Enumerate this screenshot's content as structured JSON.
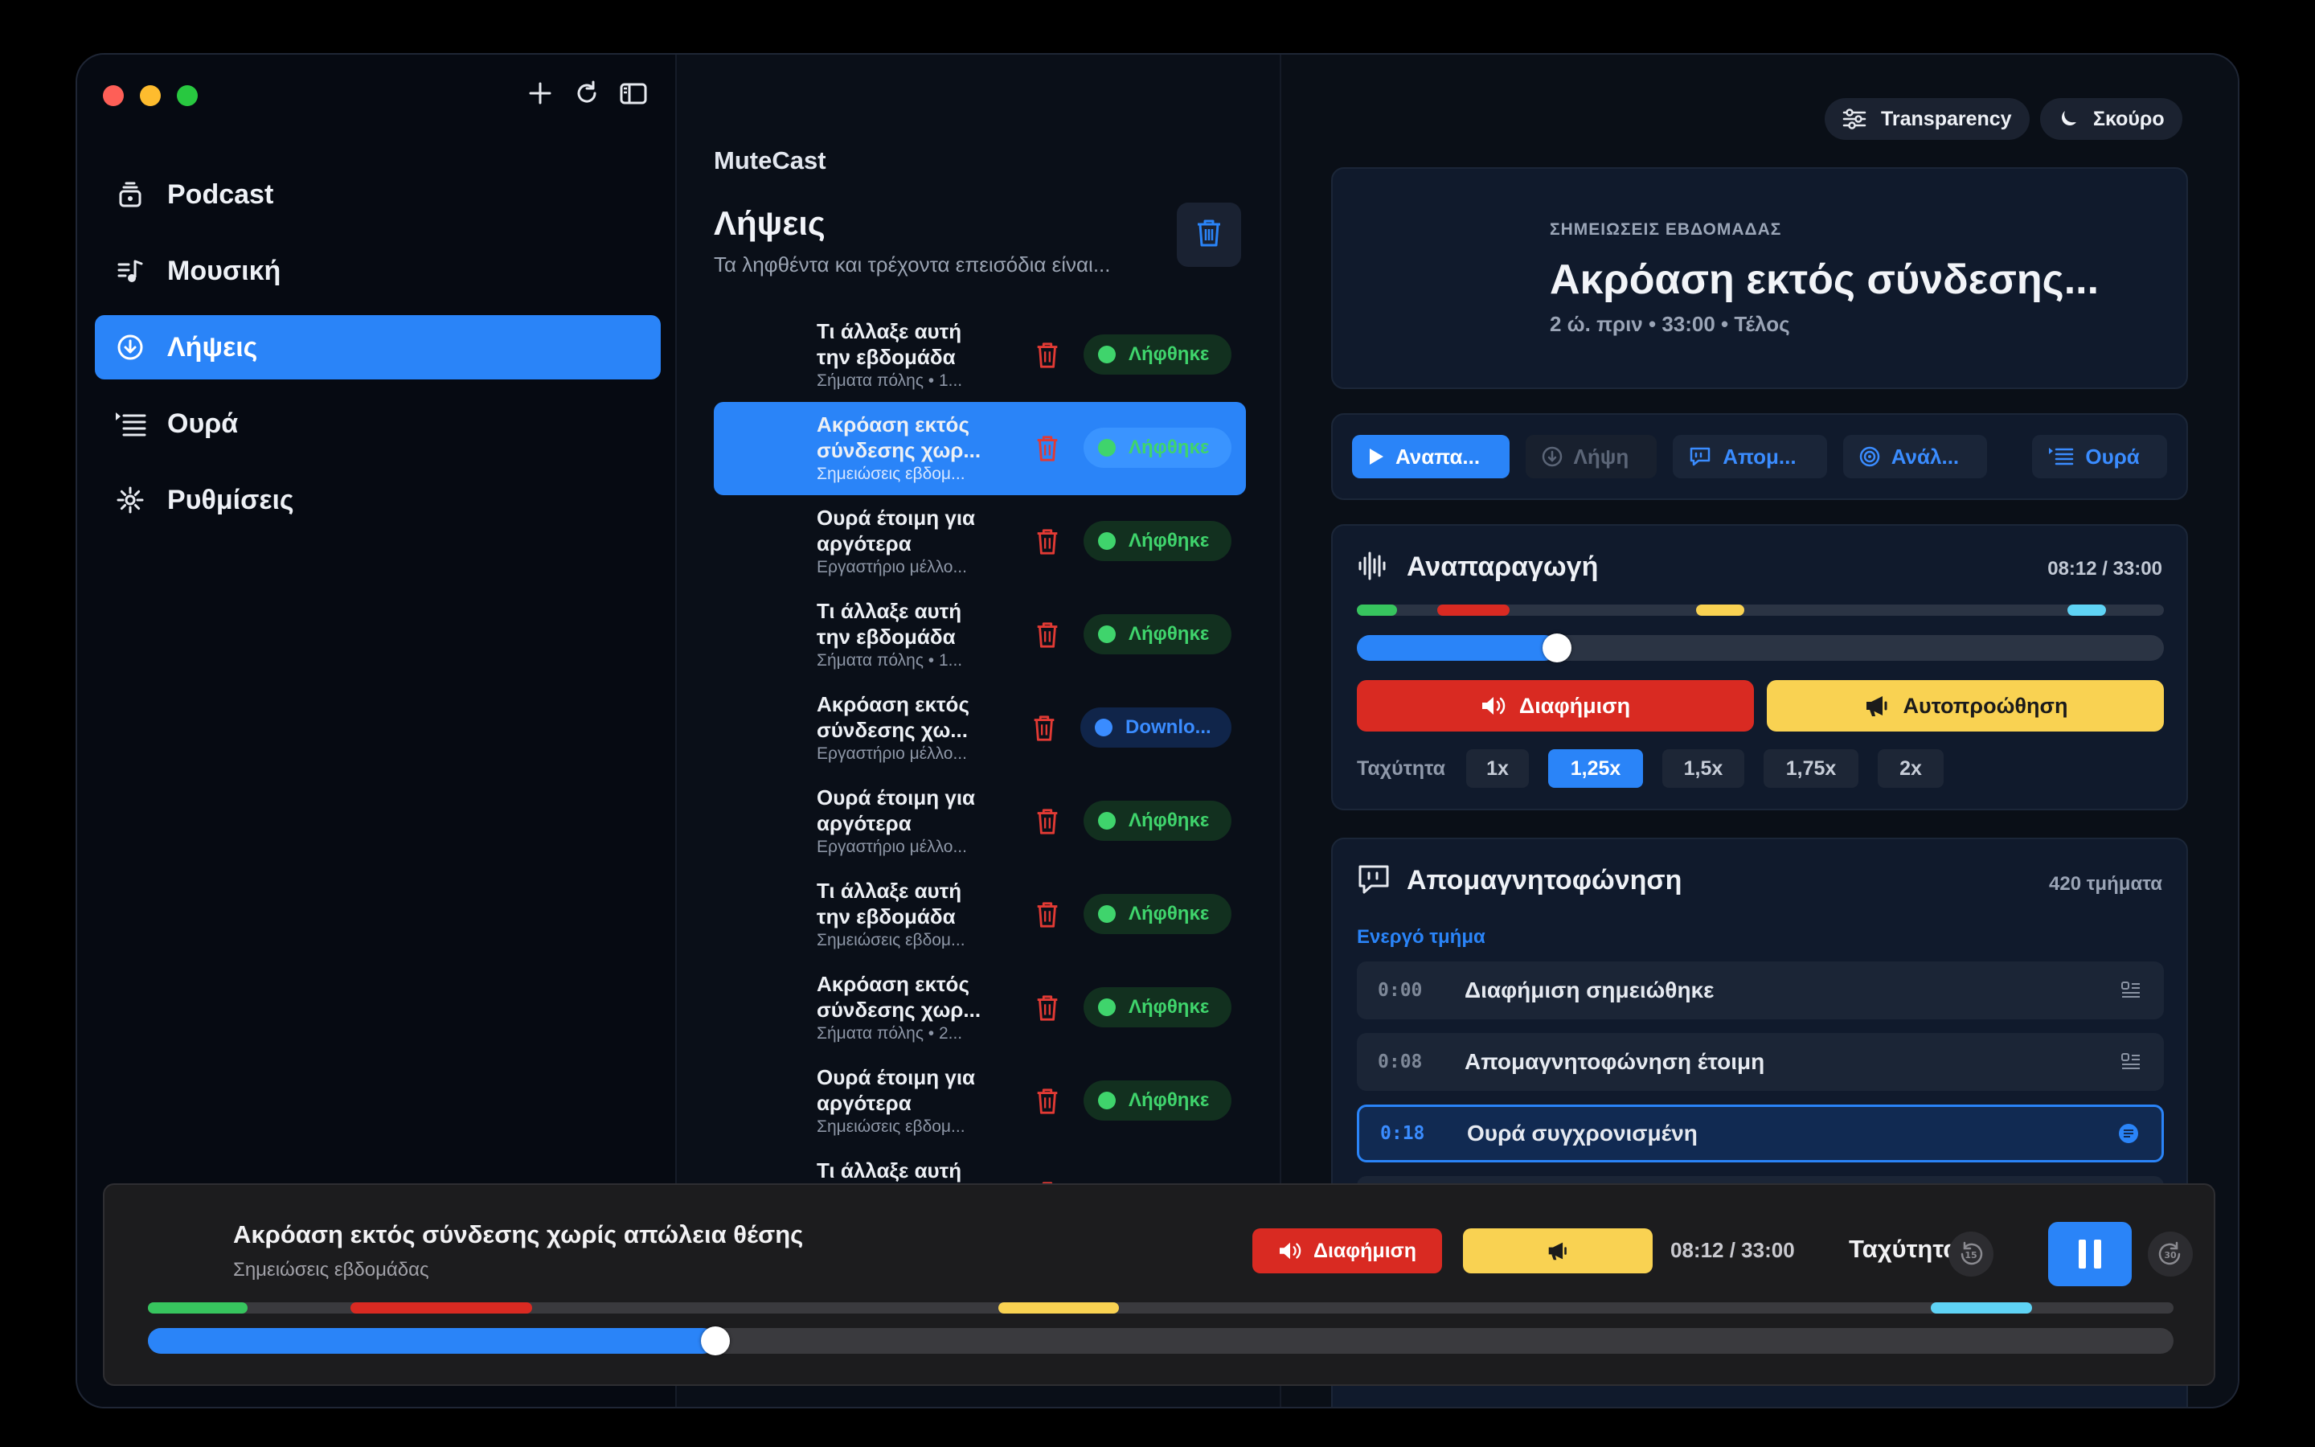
{
  "sidebar": {
    "items": [
      {
        "label": "Podcast",
        "icon": "podcast-icon"
      },
      {
        "label": "Μουσική",
        "icon": "music-icon"
      },
      {
        "label": "Λήψεις",
        "icon": "download-icon",
        "active": true
      },
      {
        "label": "Ουρά",
        "icon": "queue-icon"
      },
      {
        "label": "Ρυθμίσεις",
        "icon": "gear-icon"
      }
    ]
  },
  "list": {
    "app_name": "MuteCast",
    "title": "Λήψεις",
    "subtitle": "Τα ληφθέντα και τρέχοντα επεισόδια είναι...",
    "rows": [
      {
        "title": "Τι άλλαξε αυτή την εβδομάδα",
        "sub": "Σήματα πόλης • 1...",
        "badge": "Λήφθηκε"
      },
      {
        "title": "Ακρόαση εκτός σύνδεσης χωρ...",
        "sub": "Σημειώσεις εβδομ...",
        "badge": "Λήφθηκε"
      },
      {
        "title": "Ουρά έτοιμη για αργότερα",
        "sub": "Εργαστήριο μέλλο...",
        "badge": "Λήφθηκε"
      },
      {
        "title": "Τι άλλαξε αυτή την εβδομάδα",
        "sub": "Σήματα πόλης • 1...",
        "badge": "Λήφθηκε"
      },
      {
        "title": "Ακρόαση εκτός σύνδεσης χω...",
        "sub": "Εργαστήριο μέλλο...",
        "badge": "Downlo..."
      },
      {
        "title": "Ουρά έτοιμη για αργότερα",
        "sub": "Εργαστήριο μέλλο...",
        "badge": "Λήφθηκε"
      },
      {
        "title": "Τι άλλαξε αυτή την εβδομάδα",
        "sub": "Σημειώσεις εβδομ...",
        "badge": "Λήφθηκε"
      },
      {
        "title": "Ακρόαση εκτός σύνδεσης χωρ...",
        "sub": "Σήματα πόλης • 2...",
        "badge": "Λήφθηκε"
      },
      {
        "title": "Ουρά έτοιμη για αργότερα",
        "sub": "Σημειώσεις εβδομ...",
        "badge": "Λήφθηκε"
      },
      {
        "title": "Τι άλλαξε αυτή",
        "sub": "",
        "badge": ""
      }
    ],
    "last_sub": "Σημειώσεις εβδομ..."
  },
  "detail": {
    "transparency_label": "Transparency",
    "theme_label": "Σκούρο",
    "hero": {
      "kicker": "ΣΗΜΕΙΩΣΕΙΣ ΕΒΔΟΜΑΔΑΣ",
      "title": "Ακρόαση εκτός σύνδεσης...",
      "meta": "2 ώ. πριν • 33:00 • Τέλος"
    },
    "actions": {
      "play": "Αναπα...",
      "download": "Λήψη",
      "transcript": "Απομ...",
      "analysis": "Ανάλ...",
      "queue": "Ουρά"
    },
    "playback": {
      "title": "Αναπαραγωγή",
      "time": "08:12 / 33:00",
      "progress": 0.248,
      "ad_button": "Διαφήμιση",
      "auto_button": "Αυτοπροώθηση",
      "speed_label": "Ταχύτητα",
      "speeds": [
        "1x",
        "1,25x",
        "1,5x",
        "1,75x",
        "2x"
      ],
      "selected_speed": "1,25x"
    },
    "transcript": {
      "title": "Απομαγνητοφώνηση",
      "count": "420 τμήματα",
      "active_label": "Ενεργό τμήμα",
      "segments": [
        {
          "time": "0:00",
          "text": "Διαφήμιση σημειώθηκε"
        },
        {
          "time": "0:08",
          "text": "Απομαγνητοφώνηση έτοιμη"
        },
        {
          "time": "0:18",
          "text": "Ουρά συγχρονισμένη",
          "active": true
        }
      ]
    }
  },
  "player": {
    "title": "Ακρόαση εκτός σύνδεσης χωρίς απώλεια θέσης",
    "subtitle": "Σημειώσεις εβδομάδας",
    "ad_button": "Διαφήμιση",
    "time": "08:12 / 33:00",
    "speed_label": "Ταχύτητα",
    "progress": 0.28
  },
  "colors": {
    "accent": "#2a84f8",
    "ad_red": "#d92a22",
    "auto_yellow": "#f9d252",
    "downloaded_green": "#3fd46c",
    "segment_cyan": "#5fd3f5"
  }
}
